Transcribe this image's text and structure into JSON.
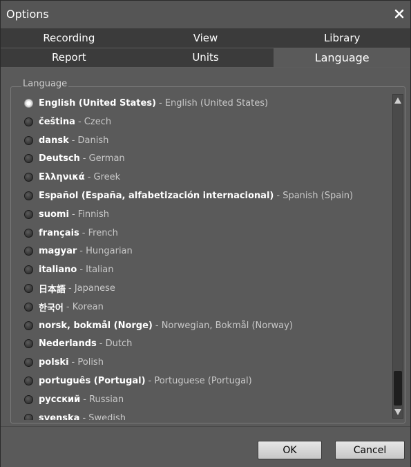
{
  "window": {
    "title": "Options"
  },
  "tabs": {
    "row1": [
      "Recording",
      "View",
      "Library"
    ],
    "row2": [
      "Report",
      "Units",
      "Language"
    ],
    "active": "Language"
  },
  "group": {
    "label": "Language"
  },
  "languages": [
    {
      "native": "English (United States)",
      "english": "English (United States)",
      "selected": true
    },
    {
      "native": "čeština",
      "english": "Czech",
      "selected": false
    },
    {
      "native": "dansk",
      "english": "Danish",
      "selected": false
    },
    {
      "native": "Deutsch",
      "english": "German",
      "selected": false
    },
    {
      "native": "Ελληνικά",
      "english": "Greek",
      "selected": false
    },
    {
      "native": "Español (España, alfabetización internacional)",
      "english": "Spanish (Spain)",
      "selected": false
    },
    {
      "native": "suomi",
      "english": "Finnish",
      "selected": false
    },
    {
      "native": "français",
      "english": "French",
      "selected": false
    },
    {
      "native": "magyar",
      "english": "Hungarian",
      "selected": false
    },
    {
      "native": "italiano",
      "english": "Italian",
      "selected": false
    },
    {
      "native": "日本語",
      "english": "Japanese",
      "selected": false
    },
    {
      "native": "한국어",
      "english": "Korean",
      "selected": false
    },
    {
      "native": "norsk, bokmål (Norge)",
      "english": "Norwegian, Bokmål (Norway)",
      "selected": false
    },
    {
      "native": "Nederlands",
      "english": "Dutch",
      "selected": false
    },
    {
      "native": "polski",
      "english": "Polish",
      "selected": false
    },
    {
      "native": "português (Portugal)",
      "english": "Portuguese (Portugal)",
      "selected": false
    },
    {
      "native": "русский",
      "english": "Russian",
      "selected": false
    },
    {
      "native": "svenska",
      "english": "Swedish",
      "selected": false
    }
  ],
  "buttons": {
    "ok": "OK",
    "cancel": "Cancel"
  },
  "icons": {
    "close": "close-icon",
    "radio": "radio-icon",
    "scroll_up": "arrow-up-icon",
    "scroll_down": "arrow-down-icon"
  },
  "colors": {
    "background": "#5a5a5a",
    "tab_inactive": "#3b3b3b",
    "text": "#ffffff",
    "secondary_text": "#c9c9c9"
  }
}
